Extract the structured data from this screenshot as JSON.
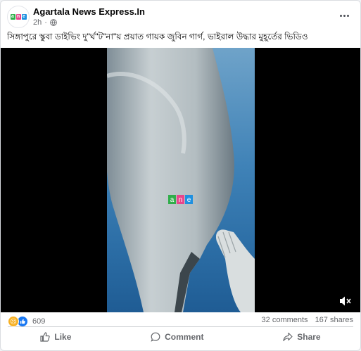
{
  "post": {
    "page_name": "Agartala News Express.In",
    "time": "2h",
    "caption": "সিঙ্গাপুরে স্কুবা ডাইভিং দু\"র্ঘ\"ট\"না\"য় প্রয়াত  গায়ক জুবিন গার্গ, ভাইরাল উদ্ধার মুহূর্তের ভিডিও",
    "watermark": "ane",
    "reaction_count": "609",
    "comments": "32 comments",
    "shares": "167 shares"
  },
  "actions": {
    "like": "Like",
    "comment": "Comment",
    "share": "Share"
  },
  "icons": {
    "avatar": "ane-logo-icon",
    "audience": "globe-icon",
    "more": "more-horizontal-icon",
    "mute": "volume-muted-icon",
    "like": "thumbs-up-icon",
    "comment": "speech-bubble-icon",
    "share": "share-arrow-icon"
  },
  "colors": {
    "like_blue": "#1877f2",
    "sad_yellow": "#f7b125",
    "logo_green": "#2fae4a",
    "logo_pink": "#e8458b",
    "logo_blue": "#1e90e0"
  }
}
